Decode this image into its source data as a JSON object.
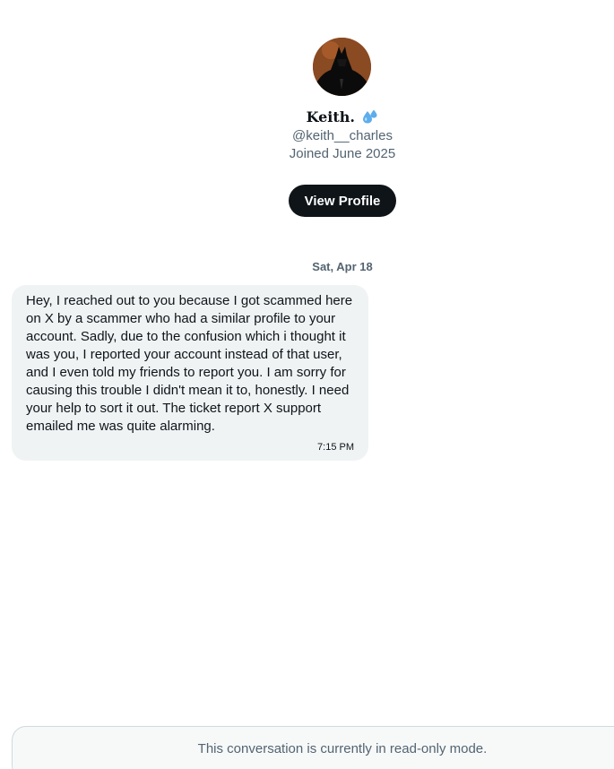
{
  "profile": {
    "name": "Keith.",
    "name_emoji_icon": "sweat-droplets-icon",
    "handle": "@keith__charles",
    "joined": "Joined June 2025",
    "view_profile_label": "View Profile",
    "avatar_icon": "avatar-dark-figure-orange-background"
  },
  "conversation": {
    "date_separator": "Sat, Apr 18",
    "messages": [
      {
        "text": "Hey, I reached out to you because I got scammed here on X by a scammer who had a similar profile to your account. Sadly, due to the confusion which i thought it was you, I reported your account instead of that user, and I even told my friends to report you. I am sorry for causing this trouble I didn't mean it to, honestly. I need your help to sort it out. The ticket report X support emailed me was quite alarming.",
        "time": "7:15 PM"
      }
    ]
  },
  "footer": {
    "readonly_notice": "This conversation is currently in read-only mode."
  },
  "colors": {
    "primary_text": "#0f1419",
    "secondary_text": "#536471",
    "bubble_bg": "#eff3f4",
    "button_bg": "#0f1419",
    "avatar_bg": "#8a4a22"
  }
}
